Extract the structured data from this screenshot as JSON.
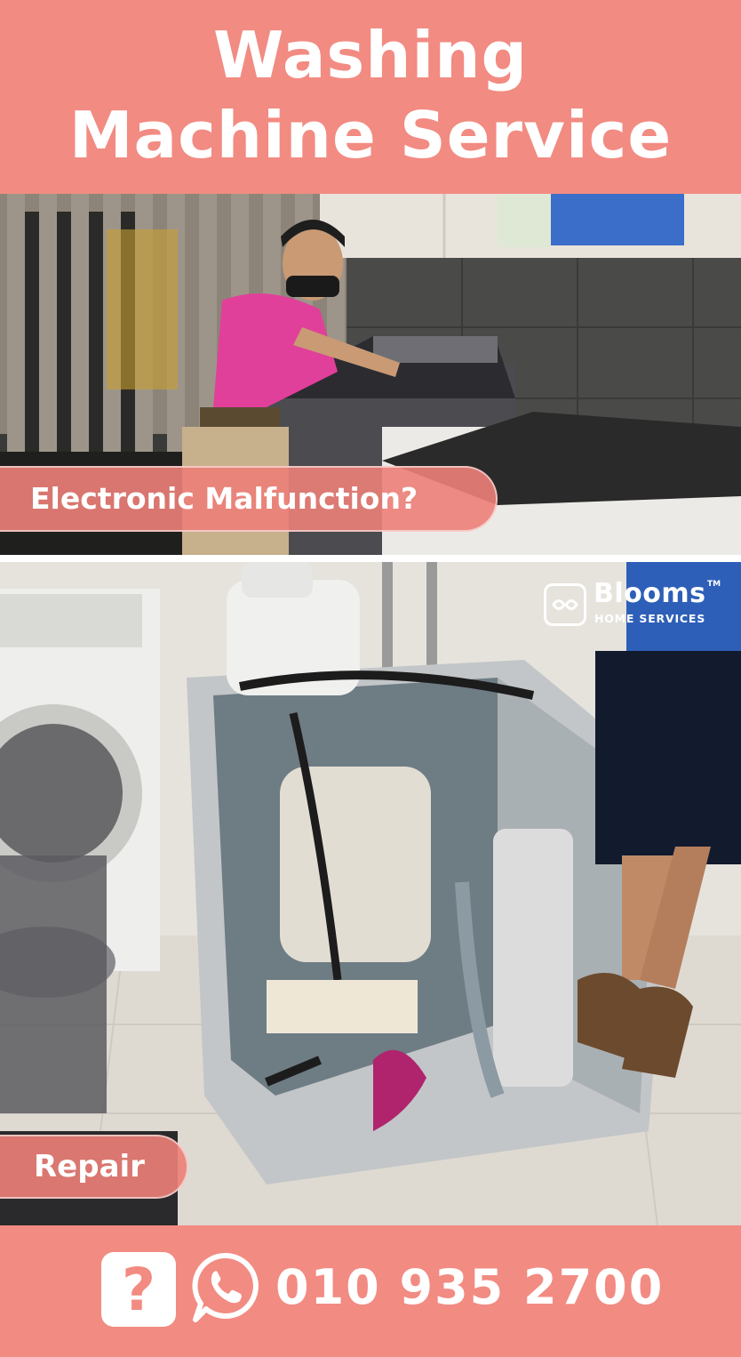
{
  "header": {
    "title_line1": "Washing",
    "title_line2": "Machine Service"
  },
  "photo1": {
    "caption": "Electronic Malfunction?"
  },
  "photo2": {
    "caption": "Repair"
  },
  "logo": {
    "name": "Blooms",
    "trademark": "TM",
    "subtitle": "HOME SERVICES"
  },
  "footer": {
    "help_icon": "question-mark-icon",
    "whatsapp_icon": "whatsapp-icon",
    "phone": "010 935 2700"
  },
  "colors": {
    "brand": "#f28b82",
    "text": "#ffffff"
  }
}
